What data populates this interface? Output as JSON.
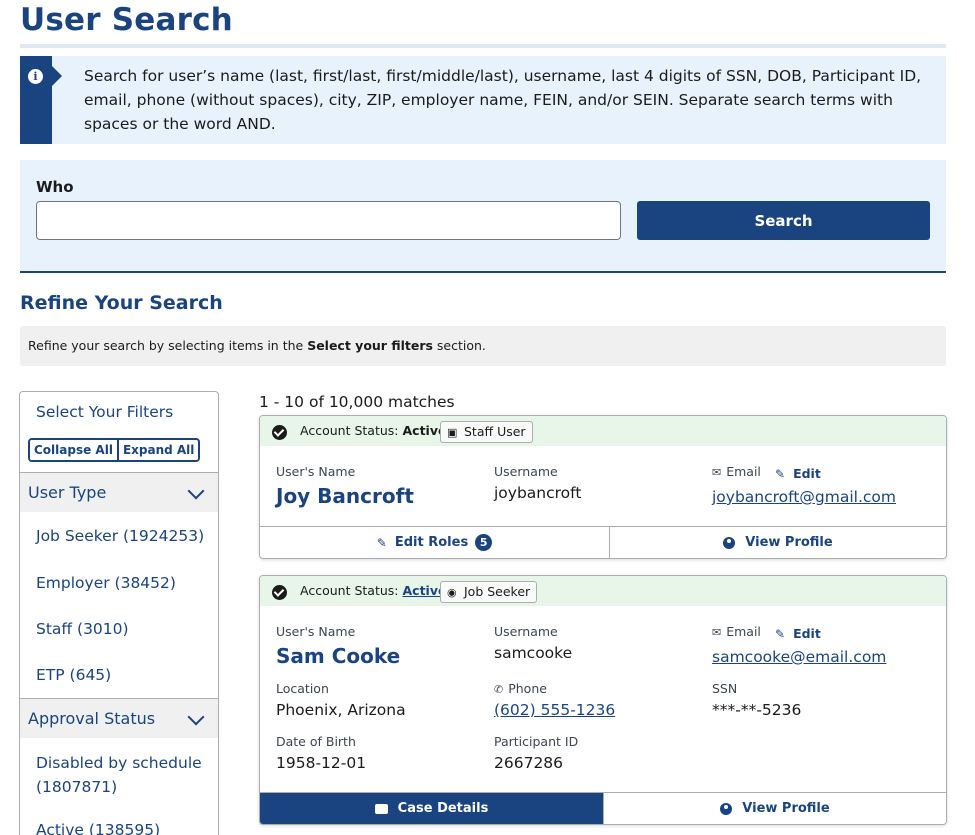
{
  "page": {
    "title": "User Search"
  },
  "info": {
    "text": "Search for user’s name (last, first/last, first/middle/last), username, last 4 digits of SSN, DOB, Participant ID, email, phone (without spaces), city, ZIP, employer name, FEIN, and/or SEIN. Separate search terms with spaces or the word AND."
  },
  "who": {
    "label": "Who",
    "value": "",
    "placeholder": "",
    "search_label": "Search"
  },
  "refine": {
    "title": "Refine Your Search",
    "hint_pre": "Refine your search by selecting items in the ",
    "hint_bold": "Select your filters",
    "hint_post": " section."
  },
  "filters": {
    "title": "Select Your Filters",
    "collapse_label": "Collapse All",
    "expand_label": "Expand All",
    "sections": [
      {
        "label": "User Type",
        "items": [
          "Job Seeker (1924253)",
          "Employer (38452)",
          "Staff (3010)",
          "ETP (645)"
        ]
      },
      {
        "label": "Approval Status",
        "items": [
          "Disabled by schedule (1807871)",
          "Active (138595)"
        ]
      }
    ]
  },
  "results": {
    "count_text": "1 - 10 of 10,000 matches",
    "labels": {
      "status": "Account Status:",
      "users_name": "User's Name",
      "username": "Username",
      "email": "Email",
      "edit": "Edit",
      "location": "Location",
      "phone": "Phone",
      "ssn": "SSN",
      "dob": "Date of Birth",
      "participant_id": "Participant ID",
      "view_profile": "View Profile",
      "edit_roles": "Edit Roles",
      "case_details": "Case Details"
    },
    "cards": [
      {
        "status": "Active",
        "role": "Staff User",
        "name": "Joy Bancroft",
        "username": "joybancroft",
        "email": "joybancroft@gmail.com",
        "roles_count": "5"
      },
      {
        "status": "Active",
        "role": "Job Seeker",
        "name": "Sam Cooke",
        "username": "samcooke",
        "email": "samcooke@email.com",
        "location": "Phoenix, Arizona",
        "phone": "(602) 555-1236",
        "ssn": "***-**-5236",
        "dob": "1958-12-01",
        "participant_id": "2667286"
      }
    ]
  },
  "colors": {
    "primary": "#1a4480",
    "info_bg": "#e7f2fc",
    "success_bg": "#e7f6e8"
  }
}
